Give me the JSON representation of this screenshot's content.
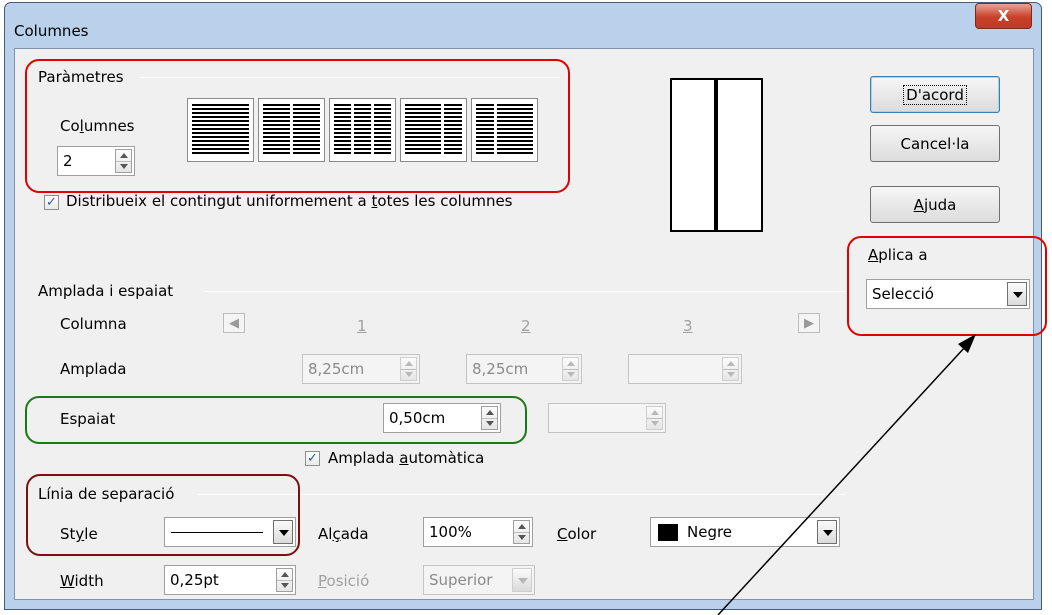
{
  "window": {
    "title": "Columnes",
    "close_glyph": "X"
  },
  "settings": {
    "group_title": "Paràmetres",
    "columns_label": "Columnes",
    "columns_value": "2",
    "presets": [
      {
        "columns": 1
      },
      {
        "columns": 2
      },
      {
        "columns": 3
      },
      {
        "columns": 2,
        "variant": "wide-left"
      },
      {
        "columns": 2,
        "variant": "wide-right"
      }
    ],
    "distribute_label": "Distribueix el contingut uniformement a totes les columnes",
    "distribute_checked": true
  },
  "buttons": {
    "ok": "D'acord",
    "cancel": "Cancel·la",
    "help": "Ajuda"
  },
  "apply_to": {
    "label": "Aplica a",
    "value": "Selecció"
  },
  "width_spacing": {
    "group_title": "Amplada i espaiat",
    "column_label": "Columna",
    "col_numbers": [
      "1",
      "2",
      "3"
    ],
    "width_label": "Amplada",
    "widths": [
      "8,25cm",
      "8,25cm",
      ""
    ],
    "spacing_label": "Espaiat",
    "spacings": [
      "0,50cm",
      ""
    ],
    "auto_width_label": "Amplada automàtica",
    "auto_width_checked": true
  },
  "separator": {
    "group_title": "Línia de separació",
    "style_label": "Style",
    "height_label": "Alçada",
    "height_value": "100%",
    "color_label": "Color",
    "color_value": "Negre",
    "color_swatch": "#000000",
    "width_label": "Width",
    "width_value": "0,25pt",
    "position_label": "Posició",
    "position_value": "Superior"
  },
  "annotations": {
    "red_outline": "#e00000",
    "green_outline": "#1a7a1a",
    "maroon_outline": "#7a1010"
  }
}
